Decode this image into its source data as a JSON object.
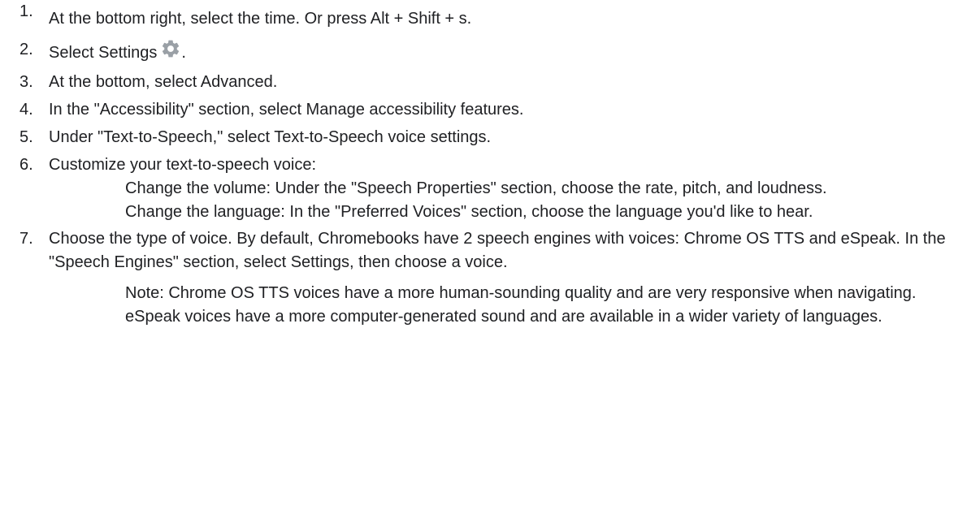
{
  "steps": [
    {
      "num": "1.",
      "text": "At the bottom right, select the time. Or press Alt + Shift + s."
    },
    {
      "num": "2.",
      "text": "Select Settings",
      "after_icon": ".",
      "icon": "gear-icon"
    },
    {
      "num": "3.",
      "text": "At the bottom, select Advanced."
    },
    {
      "num": "4.",
      "text": "In the \"Accessibility\" section, select Manage accessibility features."
    },
    {
      "num": "5.",
      "text": "Under \"Text-to-Speech,\" select Text-to-Speech voice settings."
    },
    {
      "num": "6.",
      "text": "Customize your text-to-speech voice:",
      "subs": [
        "Change the volume: Under the \"Speech Properties\" section, choose the rate, pitch, and loudness.",
        "Change the language: In the \"Preferred Voices\" section, choose the language you'd like to hear."
      ]
    },
    {
      "num": "7.",
      "text": "Choose the type of voice. By default, Chromebooks have 2 speech engines with voices: Chrome OS TTS and eSpeak. In the \"Speech Engines\" section, select Settings, then choose a voice.",
      "subs": [
        "Note: Chrome OS TTS voices have a more human-sounding quality and are very responsive when navigating. eSpeak voices have a more computer-generated sound and are available in a wider variety of languages."
      ]
    }
  ],
  "colors": {
    "text": "#202124",
    "icon": "#9aa0a6"
  }
}
